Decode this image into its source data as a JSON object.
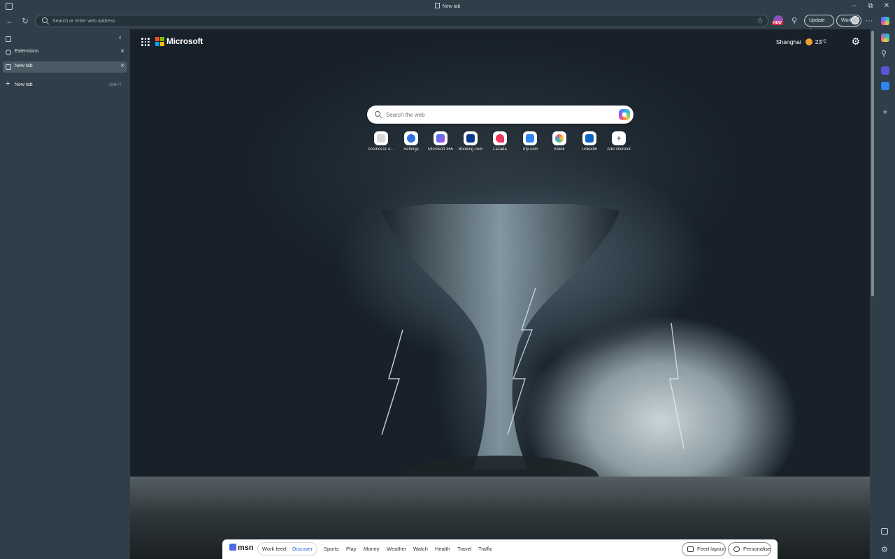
{
  "window": {
    "title": "New tab"
  },
  "toolbar": {
    "address_placeholder": "Search or enter web address",
    "new_badge": "NEW",
    "update_label": "Update",
    "profile_label": "Work",
    "more_label": "···"
  },
  "sidebar": {
    "tabs": [
      {
        "label": "Extensions"
      },
      {
        "label": "New tab"
      }
    ],
    "new_tab_label": "New tab",
    "new_tab_shortcut": "Ctrl+T"
  },
  "page": {
    "brand": "Microsoft",
    "weather": {
      "city": "Shanghai",
      "temp": "23",
      "unit": "°C"
    },
    "search_placeholder": "Search the web",
    "shortcuts": [
      {
        "label": "cosmos11 e...",
        "icon": "cosmos-icon",
        "color": "#e8e8e8"
      },
      {
        "label": "Settings",
        "icon": "settings-app-icon",
        "color": "#2f6fe0"
      },
      {
        "label": "Microsoft 365",
        "icon": "m365-icon",
        "color": "#7b4ed8"
      },
      {
        "label": "Booking.com",
        "icon": "booking-icon",
        "color": "#0b3a8c"
      },
      {
        "label": "Lazada",
        "icon": "lazada-icon",
        "color": "#f0365a"
      },
      {
        "label": "Trip.com",
        "icon": "trip-icon",
        "color": "#2f86f0"
      },
      {
        "label": "Klook",
        "icon": "klook-icon",
        "color": "#ff6b3d"
      },
      {
        "label": "LinkedIn",
        "icon": "linkedin-icon",
        "color": "#0a66c2"
      },
      {
        "label": "Add shortcut",
        "icon": "plus-icon",
        "color": "#ffffff"
      }
    ],
    "msn": {
      "logo": "msn",
      "feed_options": [
        "Work feed",
        "Discover"
      ],
      "active_feed": "Discover",
      "links": [
        "Sports",
        "Play",
        "Money",
        "Weather",
        "Watch",
        "Health",
        "Travel",
        "Traffic"
      ],
      "feed_layout_label": "Feed layout",
      "personalise_label": "Personalise"
    }
  },
  "colors": {
    "chrome": "#2f3e48",
    "accent_blue": "#2a6bd6"
  }
}
